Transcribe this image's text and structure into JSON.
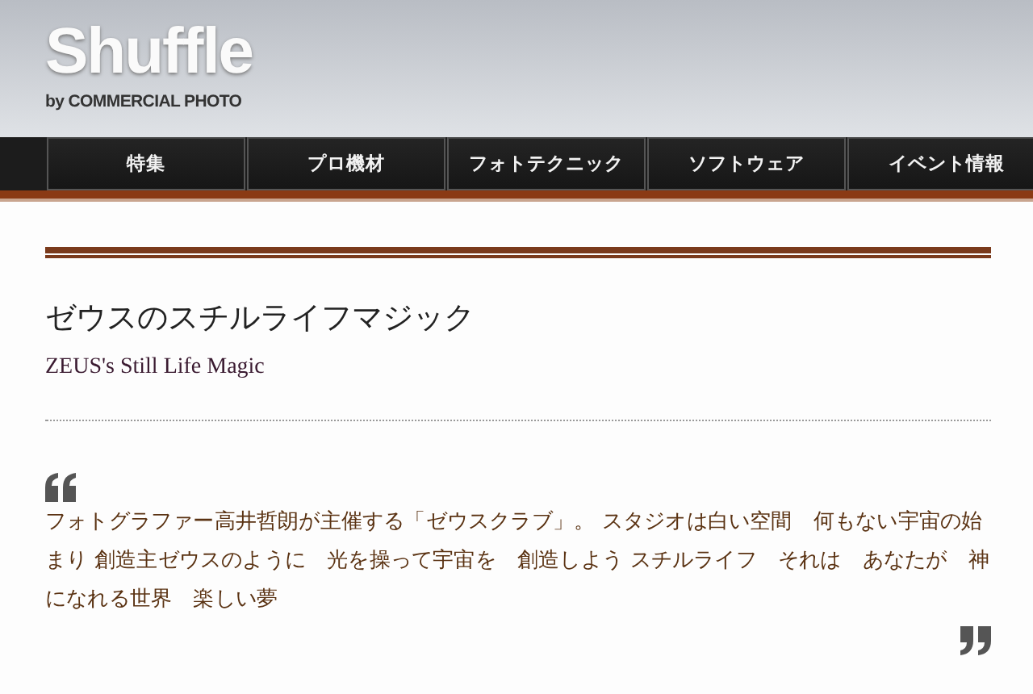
{
  "header": {
    "logo": "Shuffle",
    "tagline": "by COMMERCIAL PHOTO"
  },
  "nav": [
    {
      "label": "特集"
    },
    {
      "label": "プロ機材"
    },
    {
      "label": "フォトテクニック"
    },
    {
      "label": "ソフトウェア"
    },
    {
      "label": "イベント情報"
    }
  ],
  "article": {
    "title": "ゼウスのスチルライフマジック",
    "subtitle": "ZEUS's Still Life Magic",
    "quote": "フォトグラファー高井哲朗が主催する「ゼウスクラブ」。 スタジオは白い空間　何もない宇宙の始まり 創造主ゼウスのように　光を操って宇宙を　創造しよう スチルライフ　それは　あなたが　神になれる世界　楽しい夢"
  }
}
